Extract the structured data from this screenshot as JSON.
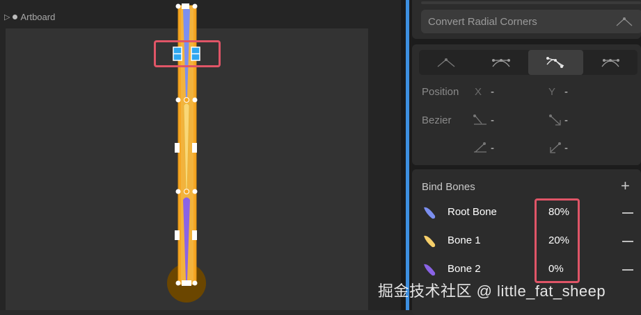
{
  "canvas": {
    "artboard_label": "Artboard",
    "play_icon": "play-outline-icon"
  },
  "panel": {
    "convert_button_label": "Convert Radial Corners",
    "vertex_modes": [
      {
        "name": "straight-vertex-icon",
        "active": false
      },
      {
        "name": "mirrored-vertex-icon",
        "active": false
      },
      {
        "name": "detached-vertex-icon",
        "active": true
      },
      {
        "name": "asymmetric-vertex-icon",
        "active": false
      }
    ],
    "position": {
      "label": "Position",
      "x_label": "X",
      "x_value": "-",
      "y_label": "Y",
      "y_value": "-"
    },
    "bezier": {
      "label": "Bezier",
      "in_value": "-",
      "out_value": "-",
      "in2_value": "-",
      "out2_value": "-"
    },
    "bind_bones": {
      "title": "Bind Bones",
      "add_symbol": "+",
      "bones": [
        {
          "name": "Root Bone",
          "weight": "80%",
          "color": "#7b8ff0"
        },
        {
          "name": "Bone 1",
          "weight": "20%",
          "color": "#f6cf6a"
        },
        {
          "name": "Bone 2",
          "weight": "0%",
          "color": "#8a63e6"
        }
      ]
    }
  },
  "colors": {
    "accent_divider": "#3d8fe0",
    "highlight": "#e05567",
    "shape_fill": "#f5a623"
  },
  "watermark": "掘金技术社区 @ little_fat_sheep"
}
